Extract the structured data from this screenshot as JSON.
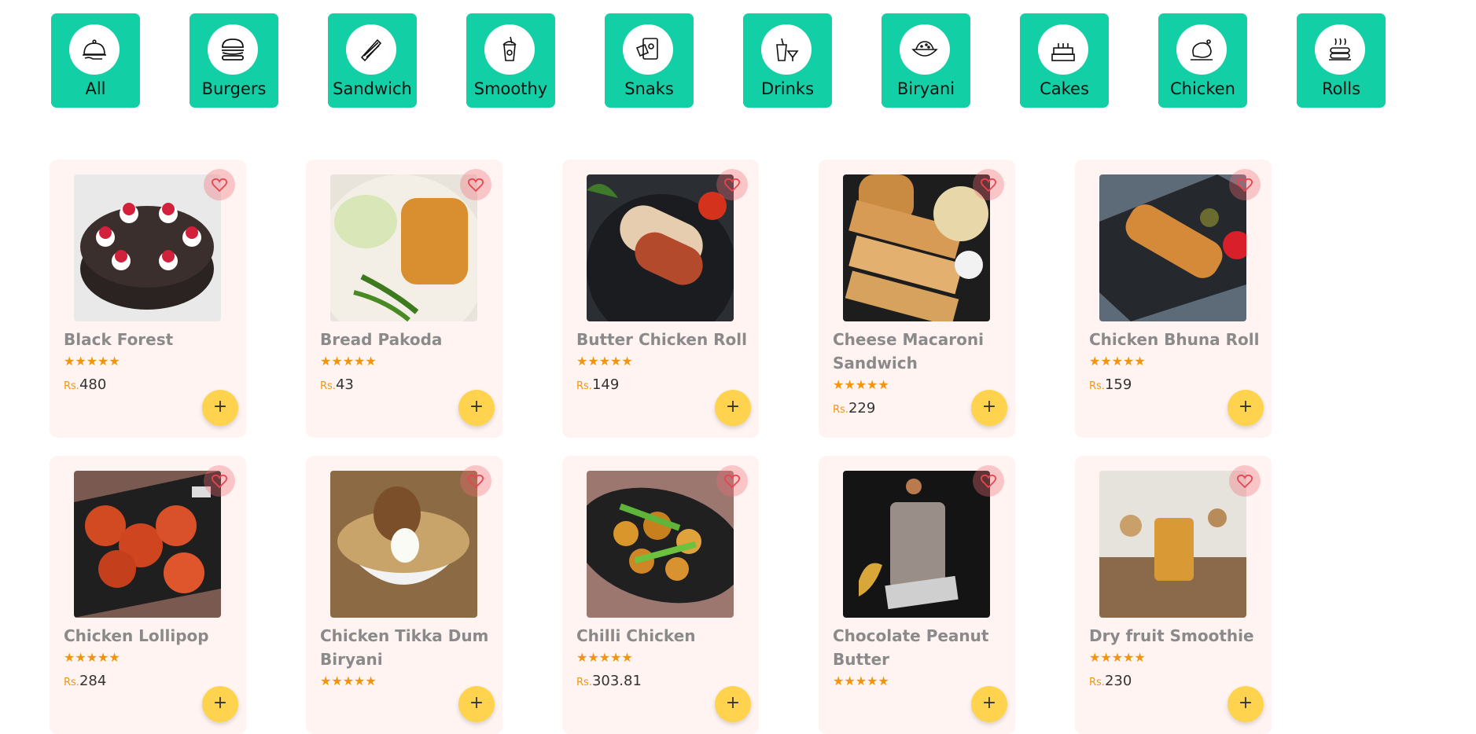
{
  "categories": [
    {
      "label": "All",
      "icon": "cloche-icon"
    },
    {
      "label": "Burgers",
      "icon": "burger-icon"
    },
    {
      "label": "Sandwich",
      "icon": "sandwich-icon"
    },
    {
      "label": "Smoothy",
      "icon": "smoothie-icon"
    },
    {
      "label": "Snaks",
      "icon": "snacks-icon"
    },
    {
      "label": "Drinks",
      "icon": "drinks-icon"
    },
    {
      "label": "Biryani",
      "icon": "biryani-icon"
    },
    {
      "label": "Cakes",
      "icon": "cake-icon"
    },
    {
      "label": "Chicken",
      "icon": "chicken-icon"
    },
    {
      "label": "Rolls",
      "icon": "rolls-icon"
    }
  ],
  "rating_stars": "★★★★★",
  "currency": "Rs.",
  "add_label": "+",
  "products": [
    {
      "name": "Black Forest",
      "price": "480",
      "image": "black-forest-cake-image"
    },
    {
      "name": "Bread Pakoda",
      "price": "43",
      "image": "bread-pakoda-image"
    },
    {
      "name": "Butter Chicken Roll",
      "price": "149",
      "image": "butter-chicken-roll-image"
    },
    {
      "name": "Cheese Macaroni Sandwich",
      "price": "229",
      "image": "cheese-macaroni-sandwich-image"
    },
    {
      "name": "Chicken Bhuna Roll",
      "price": "159",
      "image": "chicken-bhuna-roll-image"
    },
    {
      "name": "Chicken Lollipop",
      "price": "284",
      "image": "chicken-lollipop-image"
    },
    {
      "name": "Chicken Tikka Dum Biryani",
      "price": "",
      "image": "chicken-biryani-image"
    },
    {
      "name": "Chilli Chicken",
      "price": "303.81",
      "image": "chilli-chicken-image"
    },
    {
      "name": "Chocolate Peanut Butter",
      "price": "",
      "image": "chocolate-shake-image"
    },
    {
      "name": "Dry fruit Smoothie",
      "price": "230",
      "image": "dry-fruit-smoothie-image"
    }
  ],
  "colors": {
    "accent": "#12cfa5",
    "card_bg": "#fff4f1",
    "star": "#f2950c",
    "add_button": "#ffd34d",
    "heart": "#e8454f"
  }
}
